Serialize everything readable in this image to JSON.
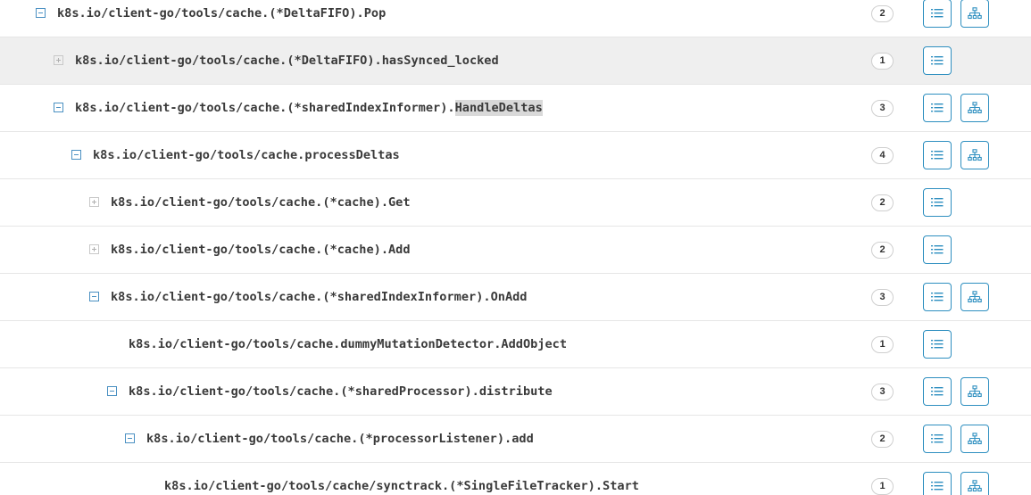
{
  "rows": [
    {
      "name": "k8s.io/client-go/tools/cache.(*DeltaFIFO).Pop",
      "count": "2",
      "state": "expanded",
      "depth": 0,
      "has_tree": true,
      "highlight": false
    },
    {
      "name": "k8s.io/client-go/tools/cache.(*DeltaFIFO).hasSynced_locked",
      "count": "1",
      "state": "collapsed",
      "depth": 1,
      "has_tree": false,
      "highlight": true
    },
    {
      "name": "k8s.io/client-go/tools/cache.(*sharedIndexInformer).",
      "name_highlight": "HandleDeltas",
      "count": "3",
      "state": "expanded",
      "depth": 1,
      "has_tree": true,
      "highlight": false
    },
    {
      "name": "k8s.io/client-go/tools/cache.processDeltas",
      "count": "4",
      "state": "expanded",
      "depth": 2,
      "has_tree": true,
      "highlight": false
    },
    {
      "name": "k8s.io/client-go/tools/cache.(*cache).Get",
      "count": "2",
      "state": "collapsed",
      "depth": 3,
      "has_tree": false,
      "highlight": false
    },
    {
      "name": "k8s.io/client-go/tools/cache.(*cache).Add",
      "count": "2",
      "state": "collapsed",
      "depth": 3,
      "has_tree": false,
      "highlight": false
    },
    {
      "name": "k8s.io/client-go/tools/cache.(*sharedIndexInformer).OnAdd",
      "count": "3",
      "state": "expanded",
      "depth": 3,
      "has_tree": true,
      "highlight": false
    },
    {
      "name": "k8s.io/client-go/tools/cache.dummyMutationDetector.AddObject",
      "count": "1",
      "state": "leaf",
      "depth": 4,
      "has_tree": false,
      "highlight": false
    },
    {
      "name": "k8s.io/client-go/tools/cache.(*sharedProcessor).distribute",
      "count": "3",
      "state": "expanded",
      "depth": 4,
      "has_tree": true,
      "highlight": false
    },
    {
      "name": "k8s.io/client-go/tools/cache.(*processorListener).add",
      "count": "2",
      "state": "expanded",
      "depth": 5,
      "has_tree": true,
      "highlight": false
    },
    {
      "name": "k8s.io/client-go/tools/cache/synctrack.(*SingleFileTracker).Start",
      "count": "1",
      "state": "leaf",
      "depth": 6,
      "has_tree": true,
      "highlight": false
    }
  ],
  "icons": {
    "list_button": "list-icon",
    "tree_button": "hierarchy-icon",
    "expanded_toggle": "minus-icon",
    "collapsed_toggle": "plus-icon"
  },
  "colors": {
    "accent": "#2e8fc0",
    "row_highlight": "#efefef",
    "text": "#3a3a3a"
  }
}
